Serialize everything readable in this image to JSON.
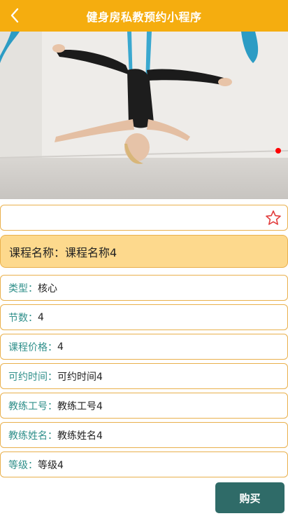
{
  "header": {
    "title": "健身房私教预约小程序",
    "back_icon": "chevron-left-icon"
  },
  "hero": {
    "image": "aerial-yoga-photo",
    "carousel_indicator_color": "#ff0000"
  },
  "favorite": {
    "icon": "star-outline-icon",
    "color": "#e23c3c"
  },
  "course": {
    "name_label": "课程名称：",
    "name_value": "课程名称4"
  },
  "details": [
    {
      "label": "类型：",
      "value": "核心"
    },
    {
      "label": "节数：",
      "value": "4"
    },
    {
      "label": "课程价格：",
      "value": "4"
    },
    {
      "label": "可约时间：",
      "value": "可约时间4"
    },
    {
      "label": "教练工号：",
      "value": "教练工号4"
    },
    {
      "label": "教练姓名：",
      "value": "教练姓名4"
    },
    {
      "label": "等级：",
      "value": "等级4"
    }
  ],
  "actions": {
    "buy_label": "购买"
  },
  "colors": {
    "accent": "#f5ad0f",
    "label_teal": "#2f8f8a",
    "button": "#2f6b68",
    "name_bg": "#fdd98d"
  }
}
